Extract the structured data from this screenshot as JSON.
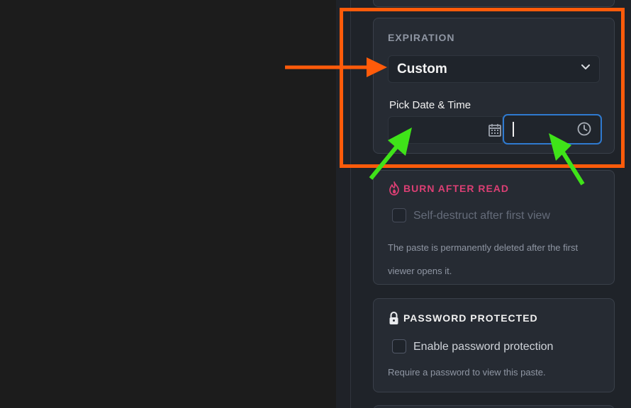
{
  "expiration": {
    "title": "EXPIRATION",
    "selected": "Custom",
    "pick_label": "Pick Date & Time"
  },
  "burn_after_read": {
    "title": "BURN AFTER READ",
    "checkbox_label": "Self-destruct after first view",
    "note": "The paste is permanently deleted after the first viewer opens it."
  },
  "password_protected": {
    "title": "PASSWORD PROTECTED",
    "checkbox_label": "Enable password protection",
    "note": "Require a password to view this paste."
  },
  "icons": {
    "select": "chevron-down-icon",
    "date": "calendar-icon",
    "time": "clock-icon",
    "burn": "flame-icon",
    "password": "lock-icon"
  },
  "colors": {
    "annotation_box": "#ff5b0a",
    "orange_arrow": "#ff5b0a",
    "green_arrows": "#3fe319",
    "focus_border": "#2f7ad0",
    "burn_accent": "#dc3f74"
  }
}
